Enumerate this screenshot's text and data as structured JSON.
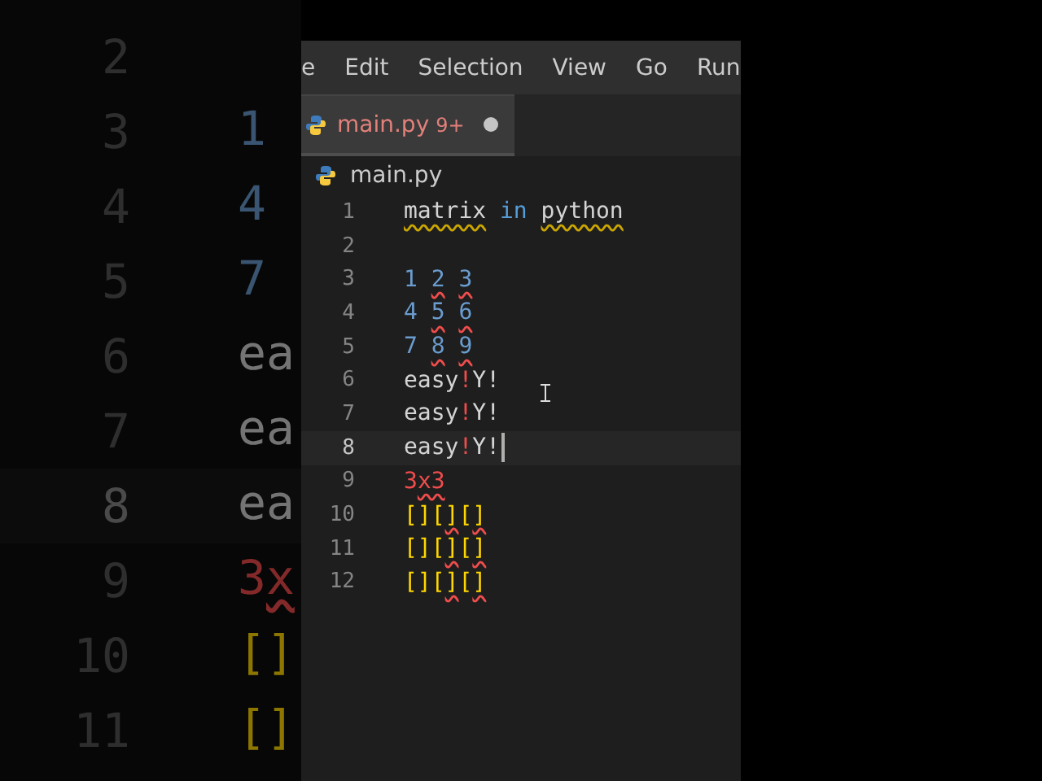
{
  "backdrop": {
    "lines": [
      {
        "number": "2",
        "current": false
      },
      {
        "number": "3",
        "current": false,
        "tokens": [
          {
            "text": "1",
            "kind": "number"
          }
        ]
      },
      {
        "number": "4",
        "current": false,
        "tokens": [
          {
            "text": "4",
            "kind": "number"
          }
        ]
      },
      {
        "number": "5",
        "current": false,
        "tokens": [
          {
            "text": "7",
            "kind": "number"
          }
        ]
      },
      {
        "number": "6",
        "current": false,
        "tokens": [
          {
            "text": "ea",
            "kind": "plain"
          }
        ]
      },
      {
        "number": "7",
        "current": false,
        "tokens": [
          {
            "text": "ea",
            "kind": "plain"
          }
        ]
      },
      {
        "number": "8",
        "current": true,
        "tokens": [
          {
            "text": "ea",
            "kind": "plain"
          }
        ]
      },
      {
        "number": "9",
        "current": false,
        "tokens": [
          {
            "text": "3",
            "kind": "error"
          },
          {
            "text": "x",
            "kind": "error",
            "error_squiggle": true
          }
        ]
      },
      {
        "number": "10",
        "current": false,
        "tokens": [
          {
            "text": "[]",
            "kind": "bracket"
          }
        ]
      },
      {
        "number": "11",
        "current": false,
        "tokens": [
          {
            "text": "[]",
            "kind": "bracket"
          }
        ]
      }
    ]
  },
  "menu": [
    "e",
    "Edit",
    "Selection",
    "View",
    "Go",
    "Run"
  ],
  "tabs": [
    {
      "label": "main.py",
      "problems": "9+",
      "modified": true,
      "selected": true
    }
  ],
  "breadcrumb": "main.py",
  "editor": {
    "lines": [
      {
        "number": "1",
        "current": false,
        "tokens": [
          {
            "text": "matrix",
            "kind": "plain",
            "warning_squiggle": true
          },
          {
            "text": "in",
            "kind": "keyword",
            "spaced": true
          },
          {
            "text": "python",
            "kind": "plain",
            "warning_squiggle": true,
            "spaced": true
          }
        ]
      },
      {
        "number": "2",
        "current": false
      },
      {
        "number": "3",
        "current": false,
        "tokens": [
          {
            "text": "1",
            "kind": "number"
          },
          {
            "text": "2",
            "kind": "number",
            "error_squiggle": true,
            "spaced": true
          },
          {
            "text": "3",
            "kind": "number",
            "error_squiggle": true,
            "spaced": true
          }
        ]
      },
      {
        "number": "4",
        "current": false,
        "tokens": [
          {
            "text": "4",
            "kind": "number"
          },
          {
            "text": "5",
            "kind": "number",
            "error_squiggle": true,
            "spaced": true
          },
          {
            "text": "6",
            "kind": "number",
            "error_squiggle": true,
            "spaced": true
          }
        ]
      },
      {
        "number": "5",
        "current": false,
        "tokens": [
          {
            "text": "7",
            "kind": "number"
          },
          {
            "text": "8",
            "kind": "number",
            "error_squiggle": true,
            "spaced": true
          },
          {
            "text": "9",
            "kind": "number",
            "error_squiggle": true,
            "spaced": true
          }
        ]
      },
      {
        "number": "6",
        "current": false,
        "tokens": [
          {
            "text": "easy",
            "kind": "plain"
          },
          {
            "text": "!",
            "kind": "error"
          },
          {
            "text": "Y!",
            "kind": "plain"
          }
        ]
      },
      {
        "number": "7",
        "current": false,
        "tokens": [
          {
            "text": "easy",
            "kind": "plain"
          },
          {
            "text": "!",
            "kind": "error"
          },
          {
            "text": "Y!",
            "kind": "plain"
          }
        ]
      },
      {
        "number": "8",
        "current": true,
        "tokens": [
          {
            "text": "easy",
            "kind": "plain"
          },
          {
            "text": "!",
            "kind": "error"
          },
          {
            "text": "Y!",
            "kind": "plain"
          }
        ]
      },
      {
        "number": "9",
        "current": false,
        "tokens": [
          {
            "text": "3",
            "kind": "error"
          },
          {
            "text": "x3",
            "kind": "error",
            "error_squiggle": true
          }
        ]
      },
      {
        "number": "10",
        "current": false,
        "tokens": [
          {
            "text": "[][",
            "kind": "bracket"
          },
          {
            "text": "]",
            "kind": "bracket",
            "error_squiggle": true
          },
          {
            "text": "[",
            "kind": "bracket"
          },
          {
            "text": "]",
            "kind": "bracket",
            "error_squiggle": true
          }
        ]
      },
      {
        "number": "11",
        "current": false,
        "tokens": [
          {
            "text": "[][",
            "kind": "bracket"
          },
          {
            "text": "]",
            "kind": "bracket",
            "error_squiggle": true
          },
          {
            "text": "[",
            "kind": "bracket"
          },
          {
            "text": "]",
            "kind": "bracket",
            "error_squiggle": true
          }
        ]
      },
      {
        "number": "12",
        "current": false,
        "tokens": [
          {
            "text": "[][",
            "kind": "bracket"
          },
          {
            "text": "]",
            "kind": "bracket",
            "error_squiggle": true
          },
          {
            "text": "[",
            "kind": "bracket"
          },
          {
            "text": "]",
            "kind": "bracket",
            "error_squiggle": true
          }
        ]
      }
    ]
  }
}
